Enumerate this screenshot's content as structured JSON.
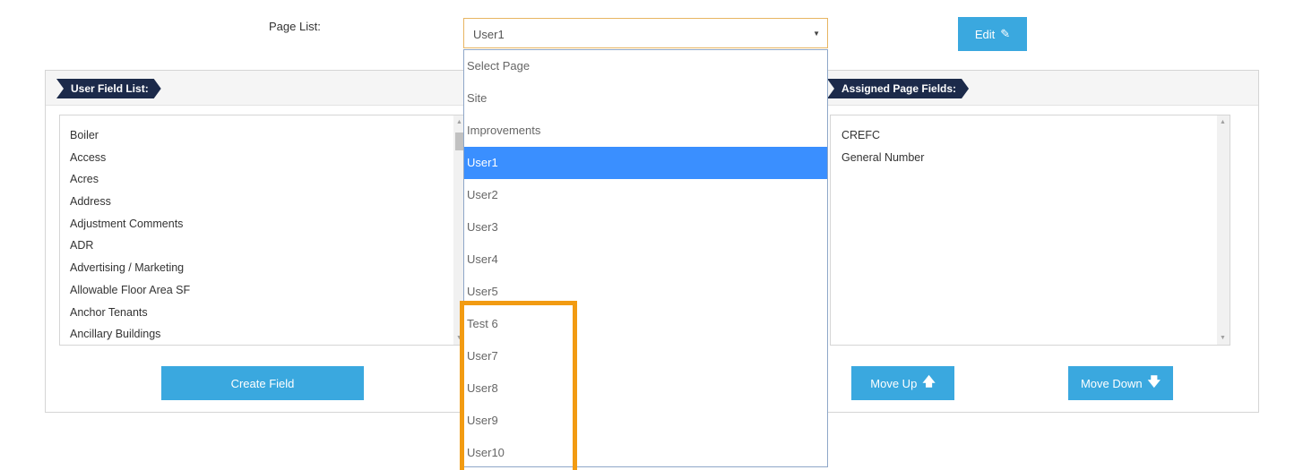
{
  "page_list": {
    "label": "Page List:",
    "selected_value": "User1",
    "caret": "▼"
  },
  "edit_button": {
    "label": "Edit",
    "icon": "✎"
  },
  "dropdown": {
    "options": [
      "Select Page",
      "Site",
      "Improvements",
      "User1",
      "User2",
      "User3",
      "User4",
      "User5",
      "Test 6",
      "User7",
      "User8",
      "User9",
      "User10"
    ],
    "selected_index": 3
  },
  "user_field_list": {
    "title": "User Field List:",
    "items": [
      "Boiler",
      "Access",
      "Acres",
      "Address",
      "Adjustment Comments",
      "ADR",
      "Advertising / Marketing",
      "Allowable Floor Area SF",
      "Anchor Tenants",
      "Ancillary Buildings"
    ]
  },
  "assigned_page_fields": {
    "title": "Assigned Page Fields:",
    "items": [
      "CREFC",
      "General Number"
    ]
  },
  "buttons": {
    "create_field": "Create Field",
    "move_up": "Move Up",
    "move_up_icon": "🡅",
    "move_down": "Move Down",
    "move_down_icon": "🡇"
  },
  "scroll": {
    "up_arrow": "▲",
    "down_arrow": "▼"
  },
  "colors": {
    "button_blue": "#3aa8df",
    "ribbon_navy": "#1c2a4a",
    "selected_option": "#3a8fff",
    "highlight_orange": "#f29b12"
  }
}
